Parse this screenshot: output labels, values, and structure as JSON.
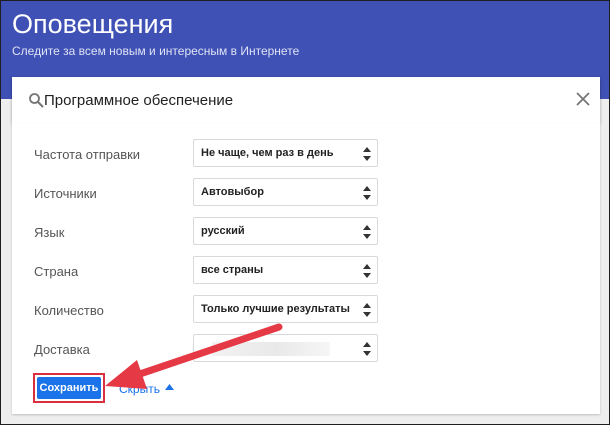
{
  "header": {
    "title": "Оповещения",
    "subtitle": "Следите за всем новым и интересным в Интернете",
    "color": "#3f51b5"
  },
  "search": {
    "value": "Программное обеспечение",
    "search_icon": "search-icon",
    "clear_icon": "close-icon"
  },
  "settings": [
    {
      "label": "Частота отправки",
      "value": "Не чаще, чем раз в день"
    },
    {
      "label": "Источники",
      "value": "Автовыбор"
    },
    {
      "label": "Язык",
      "value": "русский"
    },
    {
      "label": "Страна",
      "value": "все страны"
    },
    {
      "label": "Количество",
      "value": "Только лучшие результаты"
    },
    {
      "label": "Доставка",
      "value": ""
    }
  ],
  "actions": {
    "save_label": "Сохранить",
    "hide_label": "Скрыть",
    "save_color": "#1a73e8",
    "highlight_color": "#d93040"
  },
  "annotation": {
    "arrow_color": "#e53945"
  }
}
